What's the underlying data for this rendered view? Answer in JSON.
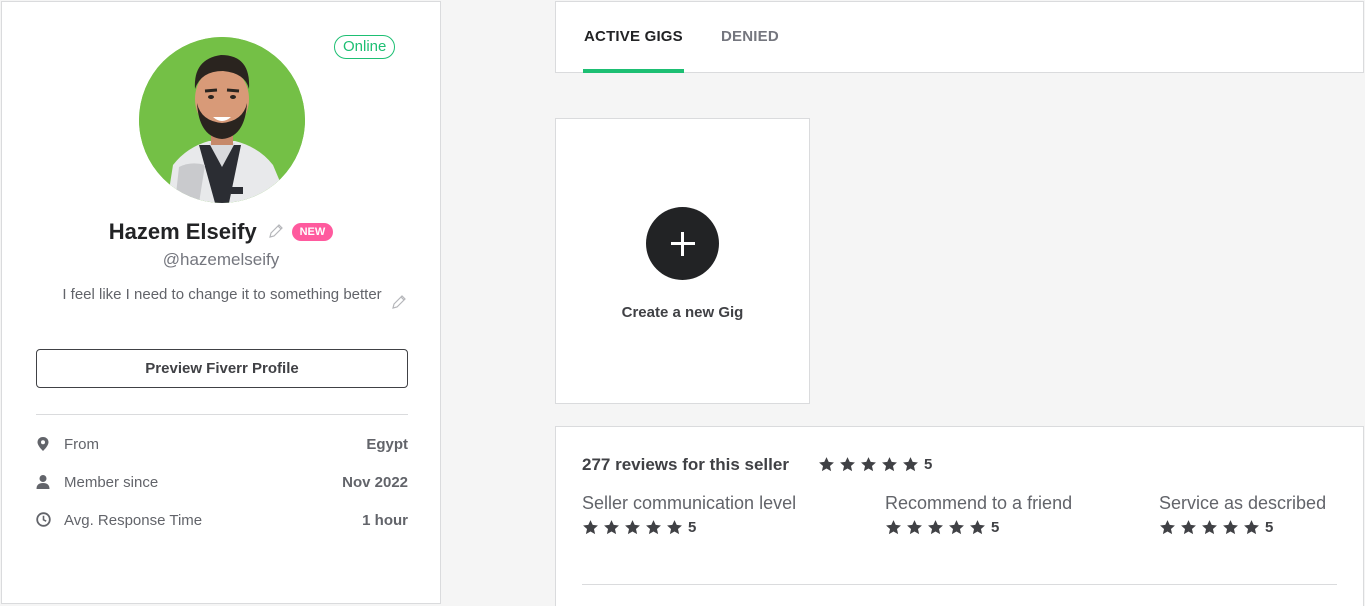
{
  "profile": {
    "status": "Online",
    "name": "Hazem Elseify",
    "badge": "NEW",
    "username": "@hazemelseify",
    "bio": "I feel like I need to change it to something better",
    "preview_button": "Preview Fiverr Profile",
    "stats": [
      {
        "icon": "location-pin-icon",
        "label": "From",
        "value": "Egypt"
      },
      {
        "icon": "user-icon",
        "label": "Member since",
        "value": "Nov 2022"
      },
      {
        "icon": "clock-icon",
        "label": "Avg. Response Time",
        "value": "1 hour"
      }
    ]
  },
  "tabs": [
    {
      "label": "ACTIVE GIGS",
      "active": true
    },
    {
      "label": "DENIED",
      "active": false
    }
  ],
  "gig": {
    "create_label": "Create a new Gig"
  },
  "reviews": {
    "heading": "277 reviews for this seller",
    "overall_score": "5",
    "criteria": [
      {
        "label": "Seller communication level",
        "score": "5"
      },
      {
        "label": "Recommend to a friend",
        "score": "5"
      },
      {
        "label": "Service as described",
        "score": "5"
      }
    ]
  },
  "colors": {
    "accent_green": "#1dbf73",
    "new_badge_pink": "#ff5a9e",
    "avatar_bg": "#74c046",
    "text_dark": "#404145"
  }
}
